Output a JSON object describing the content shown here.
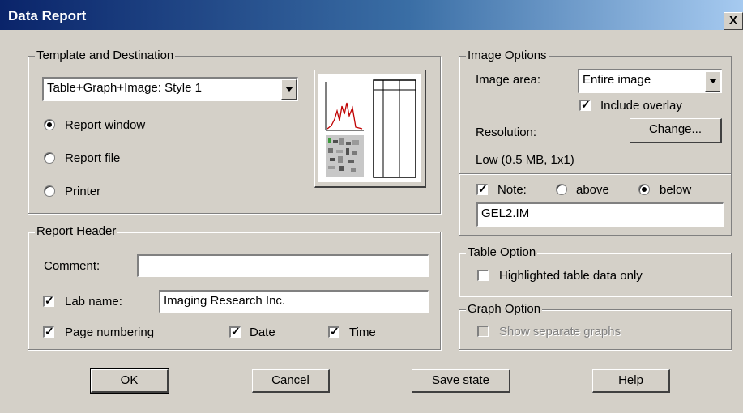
{
  "window": {
    "title": "Data Report",
    "close_glyph": "X"
  },
  "template_destination": {
    "legend": "Template and Destination",
    "template_selected": "Table+Graph+Image: Style 1",
    "destinations": [
      {
        "label": "Report window",
        "selected": true
      },
      {
        "label": "Report file",
        "selected": false
      },
      {
        "label": "Printer",
        "selected": false
      }
    ]
  },
  "report_header": {
    "legend": "Report Header",
    "comment_label": "Comment:",
    "comment_value": "",
    "lab_name_label": "Lab name:",
    "lab_name_checked": true,
    "lab_name_value": "Imaging Research Inc.",
    "page_numbering_label": "Page numbering",
    "page_numbering_checked": true,
    "date_label": "Date",
    "date_checked": true,
    "time_label": "Time",
    "time_checked": true
  },
  "image_options": {
    "legend": "Image Options",
    "image_area_label": "Image area:",
    "image_area_selected": "Entire image",
    "include_overlay_label": "Include overlay",
    "include_overlay_checked": true,
    "resolution_label": "Resolution:",
    "change_button": "Change...",
    "resolution_value": "Low (0.5 MB, 1x1)",
    "note_label": "Note:",
    "note_checked": true,
    "above_label": "above",
    "below_label": "below",
    "note_position": "below",
    "note_value": "GEL2.IM"
  },
  "table_option": {
    "legend": "Table Option",
    "highlighted_label": "Highlighted table data only",
    "highlighted_checked": false
  },
  "graph_option": {
    "legend": "Graph Option",
    "separate_label": "Show separate graphs",
    "separate_checked": false,
    "separate_enabled": false
  },
  "buttons": {
    "ok": "OK",
    "cancel": "Cancel",
    "save_state": "Save state",
    "help": "Help"
  },
  "colors": {
    "dialog_bg": "#d4d0c8",
    "title_start": "#0a246a",
    "title_end": "#a6caf0",
    "graph_line": "#c00000"
  }
}
